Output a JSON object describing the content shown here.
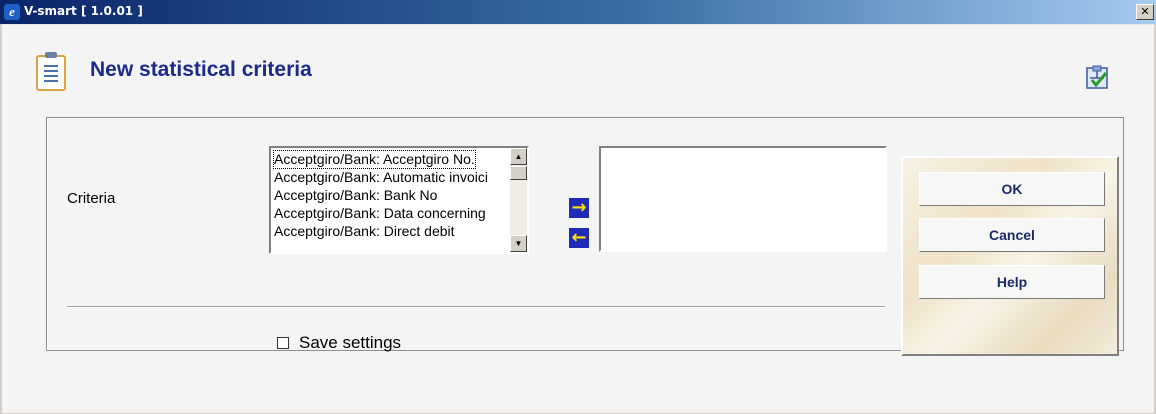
{
  "window": {
    "title": "V-smart [ 1.0.01 ]",
    "close_glyph": "✕"
  },
  "page": {
    "title": "New statistical criteria"
  },
  "form": {
    "criteria_label": "Criteria",
    "available_list": [
      "Acceptgiro/Bank: Acceptgiro No.",
      "Acceptgiro/Bank: Automatic invoici",
      "Acceptgiro/Bank: Bank No",
      "Acceptgiro/Bank: Data concerning",
      "Acceptgiro/Bank: Direct debit"
    ],
    "add_glyph": "→",
    "remove_glyph": "←",
    "selected_list": [],
    "save_settings": {
      "label": "Save settings",
      "checked": false
    }
  },
  "buttons": {
    "ok": "OK",
    "cancel": "Cancel",
    "help": "Help"
  },
  "icons": {
    "app": "ie-icon",
    "page": "clipboard-document-icon",
    "wizard": "wizard-check-icon",
    "scroll_up": "▲",
    "scroll_down": "▼"
  },
  "colors": {
    "title_text": "#1b2a8c",
    "arrow_bg": "#1d2bb8",
    "arrow_fg": "#ffe000"
  }
}
